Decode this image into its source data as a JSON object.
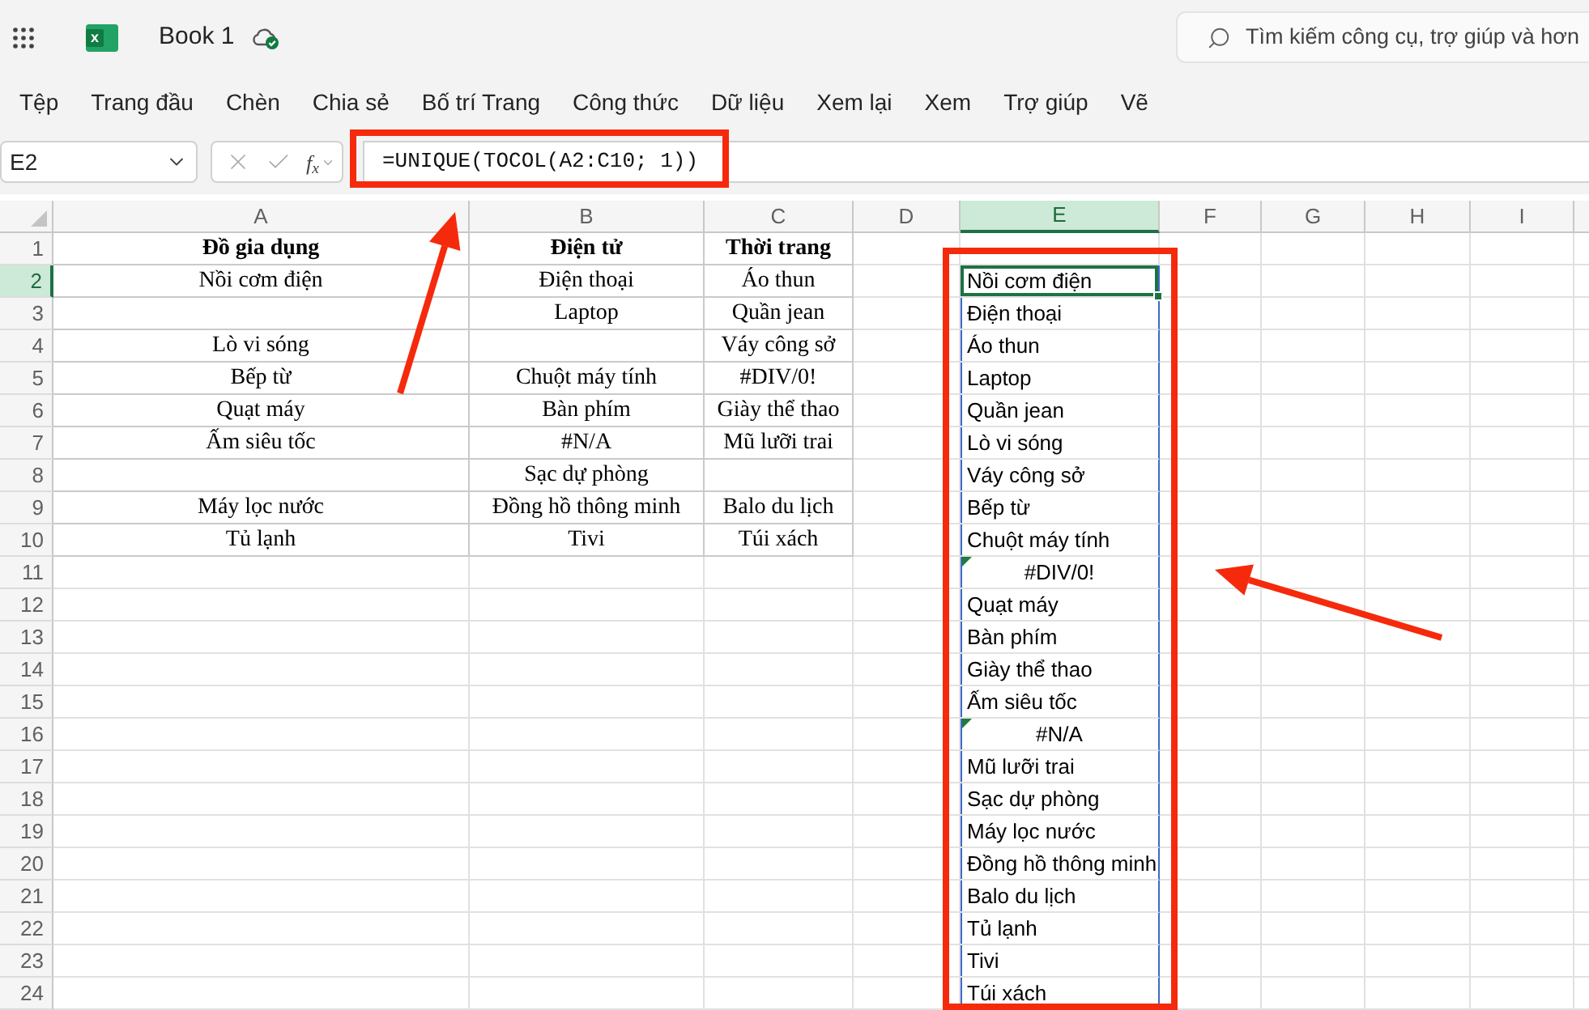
{
  "title_bar": {
    "logo_letter": "x",
    "document_title": "Book 1",
    "search": {
      "placeholder": "Tìm kiếm công cụ, trợ giúp và hơn"
    }
  },
  "menu": [
    "Tệp",
    "Trang đầu",
    "Chèn",
    "Chia sẻ",
    "Bố trí Trang",
    "Công thức",
    "Dữ liệu",
    "Xem lại",
    "Xem",
    "Trợ giúp",
    "Vẽ"
  ],
  "formula_bar": {
    "name_box": "E2",
    "edit_controls_disabled": true,
    "function_label": "f$_{x}$",
    "formula": "=UNIQUE(TOCOL(A2:C10; 1))"
  },
  "sheet": {
    "column_headers": [
      {
        "label": "A",
        "selected": false
      },
      {
        "label": "B",
        "selected": false
      },
      {
        "label": "C",
        "selected": false
      },
      {
        "label": "D",
        "selected": false
      },
      {
        "label": "E",
        "selected": true
      },
      {
        "label": "F",
        "selected": false
      },
      {
        "label": "G",
        "selected": false
      },
      {
        "label": "H",
        "selected": false
      },
      {
        "label": "I",
        "selected": false
      }
    ],
    "row_headers": [
      {
        "label": "1",
        "selected": false
      },
      {
        "label": "2",
        "selected": true
      },
      {
        "label": "3",
        "selected": false
      },
      {
        "label": "4",
        "selected": false
      },
      {
        "label": "5",
        "selected": false
      },
      {
        "label": "6",
        "selected": false
      },
      {
        "label": "7",
        "selected": false
      },
      {
        "label": "8",
        "selected": false
      },
      {
        "label": "9",
        "selected": false
      },
      {
        "label": "10",
        "selected": false
      },
      {
        "label": "11",
        "selected": false
      },
      {
        "label": "12",
        "selected": false
      },
      {
        "label": "13",
        "selected": false
      },
      {
        "label": "14",
        "selected": false
      },
      {
        "label": "15",
        "selected": false
      },
      {
        "label": "16",
        "selected": false
      },
      {
        "label": "17",
        "selected": false
      },
      {
        "label": "18",
        "selected": false
      },
      {
        "label": "19",
        "selected": false
      },
      {
        "label": "20",
        "selected": false
      },
      {
        "label": "21",
        "selected": false
      },
      {
        "label": "22",
        "selected": false
      },
      {
        "label": "23",
        "selected": false
      },
      {
        "label": "24",
        "selected": false
      }
    ],
    "source_table": {
      "header": [
        "Đồ gia dụng",
        "Điện tử",
        "Thời trang"
      ],
      "rows": [
        [
          "Nồi cơm điện",
          "Điện thoại",
          "Áo thun"
        ],
        [
          null,
          "Laptop",
          "Quần jean"
        ],
        [
          "Lò vi sóng",
          null,
          "Váy công sở"
        ],
        [
          "Bếp từ",
          "Chuột máy tính",
          "#DIV/0!"
        ],
        [
          "Quạt máy",
          "Bàn phím",
          "Giày thể thao"
        ],
        [
          "Ấm siêu tốc",
          "#N/A",
          "Mũ lưỡi trai"
        ],
        [
          null,
          "Sạc dự phòng",
          null
        ],
        [
          "Máy lọc nước",
          "Đồng hồ thông minh",
          "Balo du lịch"
        ],
        [
          "Tủ lạnh",
          "Tivi",
          "Túi xách"
        ]
      ]
    },
    "result_column": {
      "cells": [
        {
          "value": "Nồi cơm điện",
          "selected": true,
          "error": false
        },
        {
          "value": "Điện thoại",
          "selected": false,
          "error": false
        },
        {
          "value": "Áo thun",
          "selected": false,
          "error": false
        },
        {
          "value": "Laptop",
          "selected": false,
          "error": false
        },
        {
          "value": "Quần jean",
          "selected": false,
          "error": false
        },
        {
          "value": "Lò vi sóng",
          "selected": false,
          "error": false
        },
        {
          "value": "Váy công sở",
          "selected": false,
          "error": false
        },
        {
          "value": "Bếp từ",
          "selected": false,
          "error": false
        },
        {
          "value": "Chuột máy tính",
          "selected": false,
          "error": false
        },
        {
          "value": "#DIV/0!",
          "selected": false,
          "error": true
        },
        {
          "value": "Quạt máy",
          "selected": false,
          "error": false
        },
        {
          "value": "Bàn phím",
          "selected": false,
          "error": false
        },
        {
          "value": "Giày thể thao",
          "selected": false,
          "error": false
        },
        {
          "value": "Ấm siêu tốc",
          "selected": false,
          "error": false
        },
        {
          "value": "#N/A",
          "selected": false,
          "error": true
        },
        {
          "value": "Mũ lưỡi trai",
          "selected": false,
          "error": false
        },
        {
          "value": "Sạc dự phòng",
          "selected": false,
          "error": false
        },
        {
          "value": "Máy lọc nước",
          "selected": false,
          "error": false
        },
        {
          "value": "Đồng hồ thông minh",
          "selected": false,
          "error": false
        },
        {
          "value": "Balo du lịch",
          "selected": false,
          "error": false
        },
        {
          "value": "Tủ lạnh",
          "selected": false,
          "error": false
        },
        {
          "value": "Tivi",
          "selected": false,
          "error": false
        },
        {
          "value": "Túi xách",
          "selected": false,
          "error": false
        }
      ]
    }
  }
}
